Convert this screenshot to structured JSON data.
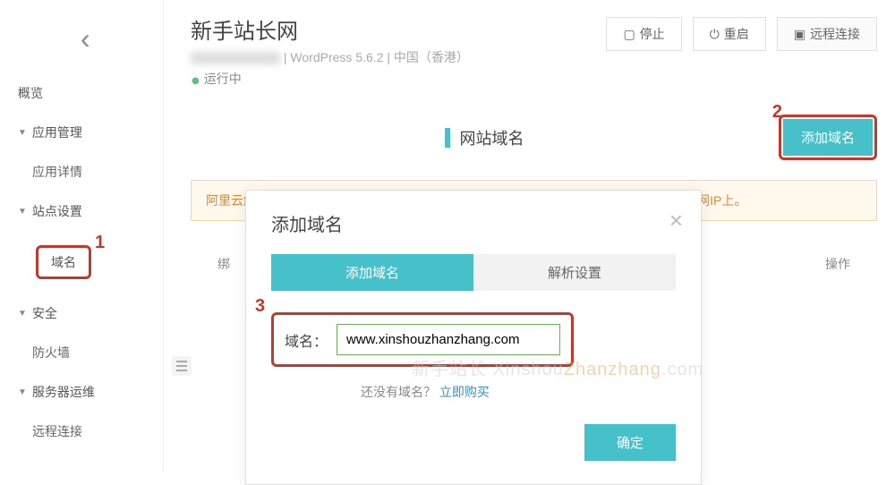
{
  "header": {
    "title": "新手站长网",
    "subtitle_suffix": " | WordPress 5.6.2 | 中国（香港）",
    "status": "运行中",
    "buttons": {
      "stop": "停止",
      "restart": "重启",
      "remote": "远程连接"
    }
  },
  "sidebar": {
    "overview": "概览",
    "app_mgmt": "应用管理",
    "app_detail": "应用详情",
    "site_settings": "站点设置",
    "domain": "域名",
    "security": "安全",
    "firewall": "防火墙",
    "server_ops": "服务器运维",
    "remote_connect": "远程连接"
  },
  "section": {
    "title": "网站域名",
    "add_button": "添加域名",
    "alert": "阿里云解析域名可在此快速设置DNS，其他域名请前往DNS服务商将域名解析到服务器公网IP上。",
    "table_head_bound": "绑",
    "table_head_ops": "操作"
  },
  "markers": {
    "m1": "1",
    "m2": "2",
    "m3": "3"
  },
  "modal": {
    "title": "添加域名",
    "tab_add": "添加域名",
    "tab_dns": "解析设置",
    "domain_label": "域名：",
    "domain_value": "www.xinshouzhanzhang.com",
    "no_domain_text": "还没有域名？",
    "buy_link": "立即购买",
    "confirm": "确定"
  },
  "watermark": {
    "pre": "新手站长 Xinshou",
    "mid": "Zhanzhang",
    "suf": ".com"
  }
}
